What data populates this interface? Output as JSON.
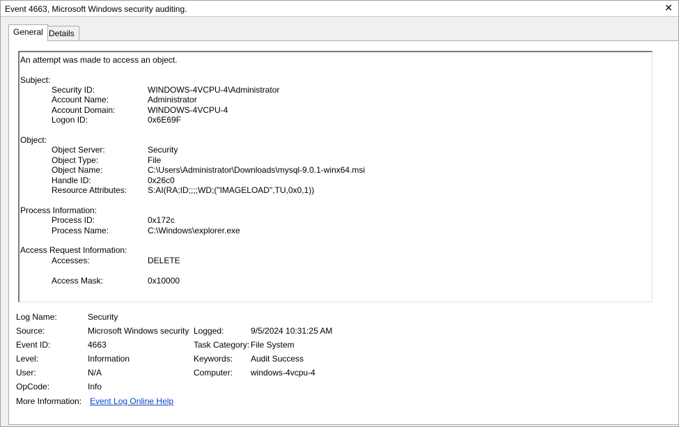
{
  "window": {
    "title": "Event 4663, Microsoft Windows security auditing.",
    "close_glyph": "✕"
  },
  "tabs": [
    {
      "label": "General",
      "active": true
    },
    {
      "label": "Details",
      "active": false
    }
  ],
  "description": {
    "intro": "An attempt was made to access an object.",
    "subject": {
      "heading": "Subject:",
      "rows": [
        {
          "label": "Security ID:",
          "value": "WINDOWS-4VCPU-4\\Administrator"
        },
        {
          "label": "Account Name:",
          "value": "Administrator"
        },
        {
          "label": "Account Domain:",
          "value": "WINDOWS-4VCPU-4"
        },
        {
          "label": "Logon ID:",
          "value": "0x6E69F"
        }
      ]
    },
    "object": {
      "heading": "Object:",
      "rows": [
        {
          "label": "Object Server:",
          "value": "Security"
        },
        {
          "label": "Object Type:",
          "value": "File"
        },
        {
          "label": "Object Name:",
          "value": "C:\\Users\\Administrator\\Downloads\\mysql-9.0.1-winx64.msi"
        },
        {
          "label": "Handle ID:",
          "value": "0x26c0"
        },
        {
          "label": "Resource Attributes:",
          "value": "S:AI(RA;ID;;;;WD;(\"IMAGELOAD\",TU,0x0,1))"
        }
      ]
    },
    "process": {
      "heading": "Process Information:",
      "rows": [
        {
          "label": "Process ID:",
          "value": "0x172c"
        },
        {
          "label": "Process Name:",
          "value": "C:\\Windows\\explorer.exe"
        }
      ]
    },
    "access": {
      "heading": "Access Request Information:",
      "rows": [
        {
          "label": "Accesses:",
          "value": "DELETE"
        },
        {
          "label": "Access Mask:",
          "value": "0x10000"
        }
      ]
    }
  },
  "meta": {
    "log_name": {
      "label": "Log Name:",
      "value": "Security"
    },
    "source": {
      "label": "Source:",
      "value": "Microsoft Windows security"
    },
    "logged": {
      "label": "Logged:",
      "value": "9/5/2024 10:31:25 AM"
    },
    "event_id": {
      "label": "Event ID:",
      "value": "4663"
    },
    "task_category": {
      "label": "Task Category:",
      "value": "File System"
    },
    "level": {
      "label": "Level:",
      "value": "Information"
    },
    "keywords": {
      "label": "Keywords:",
      "value": "Audit Success"
    },
    "user": {
      "label": "User:",
      "value": "N/A"
    },
    "computer": {
      "label": "Computer:",
      "value": "windows-4vcpu-4"
    },
    "opcode": {
      "label": "OpCode:",
      "value": "Info"
    },
    "more_info": {
      "label": "More Information:",
      "link": "Event Log Online Help"
    }
  }
}
